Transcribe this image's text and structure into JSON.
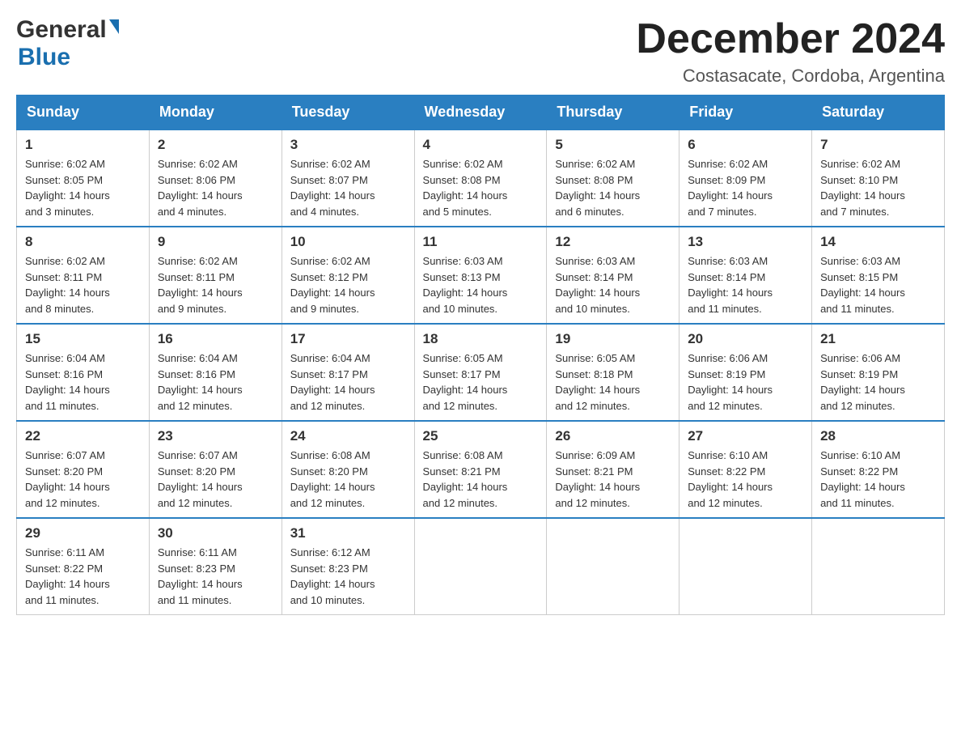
{
  "header": {
    "logo": {
      "general": "General",
      "triangle": "▶",
      "blue": "Blue"
    },
    "title": "December 2024",
    "location": "Costasacate, Cordoba, Argentina"
  },
  "weekdays": [
    "Sunday",
    "Monday",
    "Tuesday",
    "Wednesday",
    "Thursday",
    "Friday",
    "Saturday"
  ],
  "weeks": [
    [
      {
        "day": "1",
        "sunrise": "6:02 AM",
        "sunset": "8:05 PM",
        "daylight": "14 hours and 3 minutes."
      },
      {
        "day": "2",
        "sunrise": "6:02 AM",
        "sunset": "8:06 PM",
        "daylight": "14 hours and 4 minutes."
      },
      {
        "day": "3",
        "sunrise": "6:02 AM",
        "sunset": "8:07 PM",
        "daylight": "14 hours and 4 minutes."
      },
      {
        "day": "4",
        "sunrise": "6:02 AM",
        "sunset": "8:08 PM",
        "daylight": "14 hours and 5 minutes."
      },
      {
        "day": "5",
        "sunrise": "6:02 AM",
        "sunset": "8:08 PM",
        "daylight": "14 hours and 6 minutes."
      },
      {
        "day": "6",
        "sunrise": "6:02 AM",
        "sunset": "8:09 PM",
        "daylight": "14 hours and 7 minutes."
      },
      {
        "day": "7",
        "sunrise": "6:02 AM",
        "sunset": "8:10 PM",
        "daylight": "14 hours and 7 minutes."
      }
    ],
    [
      {
        "day": "8",
        "sunrise": "6:02 AM",
        "sunset": "8:11 PM",
        "daylight": "14 hours and 8 minutes."
      },
      {
        "day": "9",
        "sunrise": "6:02 AM",
        "sunset": "8:11 PM",
        "daylight": "14 hours and 9 minutes."
      },
      {
        "day": "10",
        "sunrise": "6:02 AM",
        "sunset": "8:12 PM",
        "daylight": "14 hours and 9 minutes."
      },
      {
        "day": "11",
        "sunrise": "6:03 AM",
        "sunset": "8:13 PM",
        "daylight": "14 hours and 10 minutes."
      },
      {
        "day": "12",
        "sunrise": "6:03 AM",
        "sunset": "8:14 PM",
        "daylight": "14 hours and 10 minutes."
      },
      {
        "day": "13",
        "sunrise": "6:03 AM",
        "sunset": "8:14 PM",
        "daylight": "14 hours and 11 minutes."
      },
      {
        "day": "14",
        "sunrise": "6:03 AM",
        "sunset": "8:15 PM",
        "daylight": "14 hours and 11 minutes."
      }
    ],
    [
      {
        "day": "15",
        "sunrise": "6:04 AM",
        "sunset": "8:16 PM",
        "daylight": "14 hours and 11 minutes."
      },
      {
        "day": "16",
        "sunrise": "6:04 AM",
        "sunset": "8:16 PM",
        "daylight": "14 hours and 12 minutes."
      },
      {
        "day": "17",
        "sunrise": "6:04 AM",
        "sunset": "8:17 PM",
        "daylight": "14 hours and 12 minutes."
      },
      {
        "day": "18",
        "sunrise": "6:05 AM",
        "sunset": "8:17 PM",
        "daylight": "14 hours and 12 minutes."
      },
      {
        "day": "19",
        "sunrise": "6:05 AM",
        "sunset": "8:18 PM",
        "daylight": "14 hours and 12 minutes."
      },
      {
        "day": "20",
        "sunrise": "6:06 AM",
        "sunset": "8:19 PM",
        "daylight": "14 hours and 12 minutes."
      },
      {
        "day": "21",
        "sunrise": "6:06 AM",
        "sunset": "8:19 PM",
        "daylight": "14 hours and 12 minutes."
      }
    ],
    [
      {
        "day": "22",
        "sunrise": "6:07 AM",
        "sunset": "8:20 PM",
        "daylight": "14 hours and 12 minutes."
      },
      {
        "day": "23",
        "sunrise": "6:07 AM",
        "sunset": "8:20 PM",
        "daylight": "14 hours and 12 minutes."
      },
      {
        "day": "24",
        "sunrise": "6:08 AM",
        "sunset": "8:20 PM",
        "daylight": "14 hours and 12 minutes."
      },
      {
        "day": "25",
        "sunrise": "6:08 AM",
        "sunset": "8:21 PM",
        "daylight": "14 hours and 12 minutes."
      },
      {
        "day": "26",
        "sunrise": "6:09 AM",
        "sunset": "8:21 PM",
        "daylight": "14 hours and 12 minutes."
      },
      {
        "day": "27",
        "sunrise": "6:10 AM",
        "sunset": "8:22 PM",
        "daylight": "14 hours and 12 minutes."
      },
      {
        "day": "28",
        "sunrise": "6:10 AM",
        "sunset": "8:22 PM",
        "daylight": "14 hours and 11 minutes."
      }
    ],
    [
      {
        "day": "29",
        "sunrise": "6:11 AM",
        "sunset": "8:22 PM",
        "daylight": "14 hours and 11 minutes."
      },
      {
        "day": "30",
        "sunrise": "6:11 AM",
        "sunset": "8:23 PM",
        "daylight": "14 hours and 11 minutes."
      },
      {
        "day": "31",
        "sunrise": "6:12 AM",
        "sunset": "8:23 PM",
        "daylight": "14 hours and 10 minutes."
      },
      null,
      null,
      null,
      null
    ]
  ],
  "labels": {
    "sunrise": "Sunrise:",
    "sunset": "Sunset:",
    "daylight": "Daylight:"
  }
}
